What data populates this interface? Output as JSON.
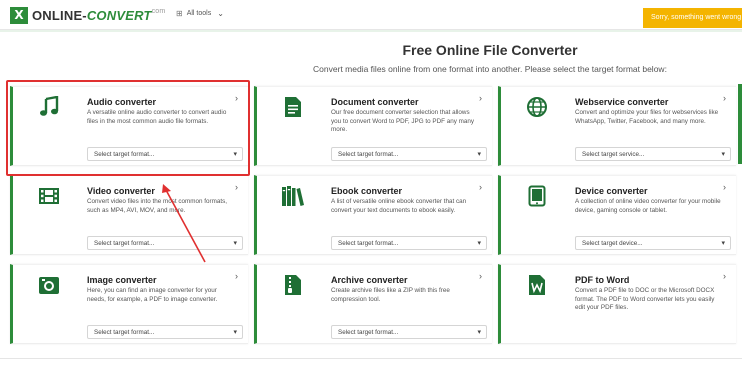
{
  "header": {
    "logo_mark": "X",
    "logo_online": "ONLINE-",
    "logo_convert": "CONVERT",
    "logo_tld": "com",
    "all_tools": "All tools",
    "alert": "Sorry, something went wrong"
  },
  "page": {
    "title": "Free Online File Converter",
    "subtitle": "Convert media files online from one format into another. Please select the target format below:"
  },
  "cards": [
    {
      "title": "Audio converter",
      "desc": "A versatile online audio converter to convert audio files in the most common audio file formats.",
      "select": "Select target format...",
      "icon": "music-note-icon"
    },
    {
      "title": "Document converter",
      "desc": "Our free document converter selection that allows you to convert Word to PDF, JPG to PDF any many more.",
      "select": "Select target format...",
      "icon": "document-icon"
    },
    {
      "title": "Webservice converter",
      "desc": "Convert and optimize your files for webservices like WhatsApp, Twitter, Facebook, and many more.",
      "select": "Select target service...",
      "icon": "globe-icon"
    },
    {
      "title": "Video converter",
      "desc": "Convert video files into the most common formats, such as MP4, AVI, MOV, and more.",
      "select": "Select target format...",
      "icon": "film-icon"
    },
    {
      "title": "Ebook converter",
      "desc": "A list of versatile online ebook converter that can convert your text documents to ebook easily.",
      "select": "Select target format...",
      "icon": "books-icon"
    },
    {
      "title": "Device converter",
      "desc": "A collection of online video converter for your mobile device, gaming console or tablet.",
      "select": "Select target device...",
      "icon": "tablet-icon"
    },
    {
      "title": "Image converter",
      "desc": "Here, you can find an image converter for your needs, for example, a PDF to image converter.",
      "select": "Select target format...",
      "icon": "image-icon"
    },
    {
      "title": "Archive converter",
      "desc": "Create archive files like a ZIP with this free compression tool.",
      "select": "Select target format...",
      "icon": "archive-icon"
    },
    {
      "title": "PDF to Word",
      "desc": "Convert a PDF file to DOC or the Microsoft DOCX format. The PDF to Word converter lets you easily edit your PDF files.",
      "select": "",
      "icon": "word-icon"
    }
  ],
  "colors": {
    "accent": "#2d8c3a",
    "alert": "#f4b400",
    "highlight": "#e03030"
  }
}
